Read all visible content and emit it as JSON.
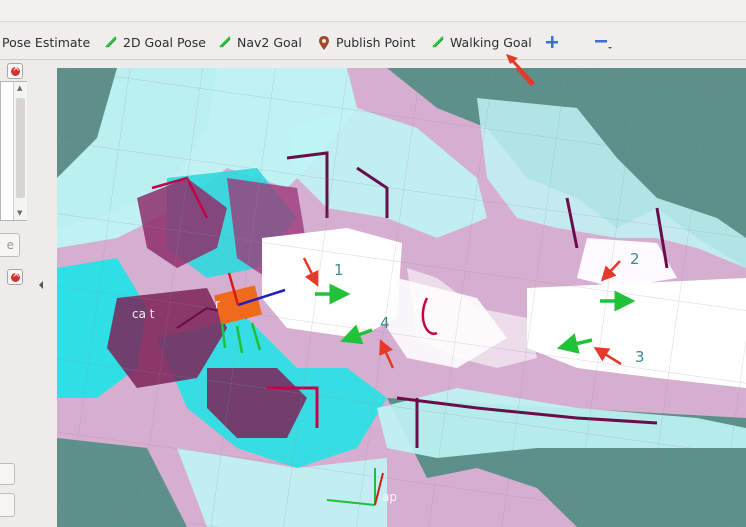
{
  "toolbar": {
    "pose_estimate": "Pose Estimate",
    "goal_pose": "2D Goal Pose",
    "nav2_goal": "Nav2 Goal",
    "publish_point": "Publish Point",
    "walking_goal": "Walking Goal"
  },
  "left_panel": {
    "button_partial": "e"
  },
  "map": {
    "labels": [
      "1",
      "2",
      "3",
      "4"
    ],
    "ghost_text": "ca          t      ",
    "ghost_text2": "r",
    "ghost_text3": "ap"
  },
  "colors": {
    "costmap_high": "#25e3e6",
    "costmap_mid": "#bff5f4",
    "inflation": "#e8b6d6",
    "obstacle": "#6a0d4a",
    "free": "#ffffff",
    "unknown": "#5d8f8b",
    "goal_arrow": "#22c13a",
    "annotation_arrow": "#e53929",
    "label": "#3a8d8a"
  },
  "icons": [
    "goal-pose-icon",
    "nav2-goal-icon",
    "publish-point-icon",
    "walking-goal-icon",
    "add-tool-icon",
    "remove-tool-icon",
    "close-icon"
  ]
}
